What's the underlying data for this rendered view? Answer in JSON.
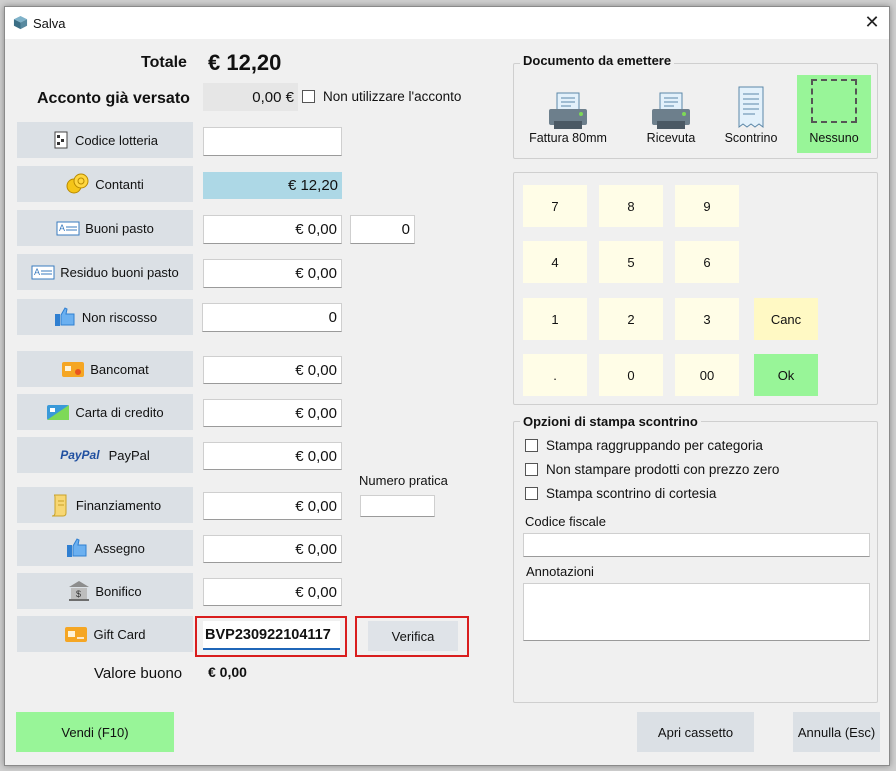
{
  "window": {
    "title": "Salva",
    "close_glyph": "✕"
  },
  "totale": {
    "label": "Totale",
    "value": "€ 12,20"
  },
  "acconto": {
    "label": "Acconto già versato",
    "value": "0,00 €",
    "checkbox_label": "Non utilizzare l'acconto"
  },
  "payments": {
    "codice_lotteria": {
      "label": "Codice lotteria",
      "value": ""
    },
    "contanti": {
      "label": "Contanti",
      "value": "€ 12,20"
    },
    "buoni_pasto": {
      "label": "Buoni pasto",
      "value": "€ 0,00",
      "count": "0"
    },
    "residuo": {
      "label": "Residuo buoni pasto",
      "value": "€ 0,00"
    },
    "non_riscosso": {
      "label": "Non riscosso",
      "value": "0"
    },
    "bancomat": {
      "label": "Bancomat",
      "value": "€ 0,00"
    },
    "carta": {
      "label": "Carta di credito",
      "value": "€ 0,00"
    },
    "paypal": {
      "label": "PayPal",
      "logo": "PayPal",
      "value": "€ 0,00"
    },
    "finanziamento": {
      "label": "Finanziamento",
      "value": "€ 0,00",
      "numero_label": "Numero pratica",
      "numero_value": ""
    },
    "assegno": {
      "label": "Assegno",
      "value": "€ 0,00"
    },
    "bonifico": {
      "label": "Bonifico",
      "value": "€ 0,00"
    },
    "gift": {
      "label": "Gift Card",
      "value": "BVP230922104117",
      "verify_label": "Verifica"
    },
    "valore": {
      "label": "Valore buono",
      "value": "€ 0,00"
    }
  },
  "documento": {
    "title": "Documento da emettere",
    "options": [
      "Fattura 80mm",
      "Ricevuta",
      "Scontrino",
      "Nessuno"
    ],
    "selected": "Nessuno",
    "selected_color": "#98f598"
  },
  "keypad": {
    "keys": [
      "7",
      "8",
      "9",
      "4",
      "5",
      "6",
      "1",
      "2",
      "3",
      ".",
      "0",
      "00"
    ],
    "canc": "Canc",
    "ok": "Ok",
    "canc_color": "#fff9c4",
    "ok_color": "#98f598"
  },
  "opzioni": {
    "title": "Opzioni di stampa scontrino",
    "checks": [
      "Stampa raggruppando per categoria",
      "Non stampare prodotti con prezzo zero",
      "Stampa scontrino di cortesia"
    ],
    "codice_fiscale_label": "Codice fiscale",
    "codice_fiscale_value": "",
    "annotazioni_label": "Annotazioni",
    "annotazioni_value": ""
  },
  "footer": {
    "vendi": "Vendi (F10)",
    "apri": "Apri cassetto",
    "annulla": "Annulla (Esc)",
    "vendi_color": "#98f598"
  }
}
